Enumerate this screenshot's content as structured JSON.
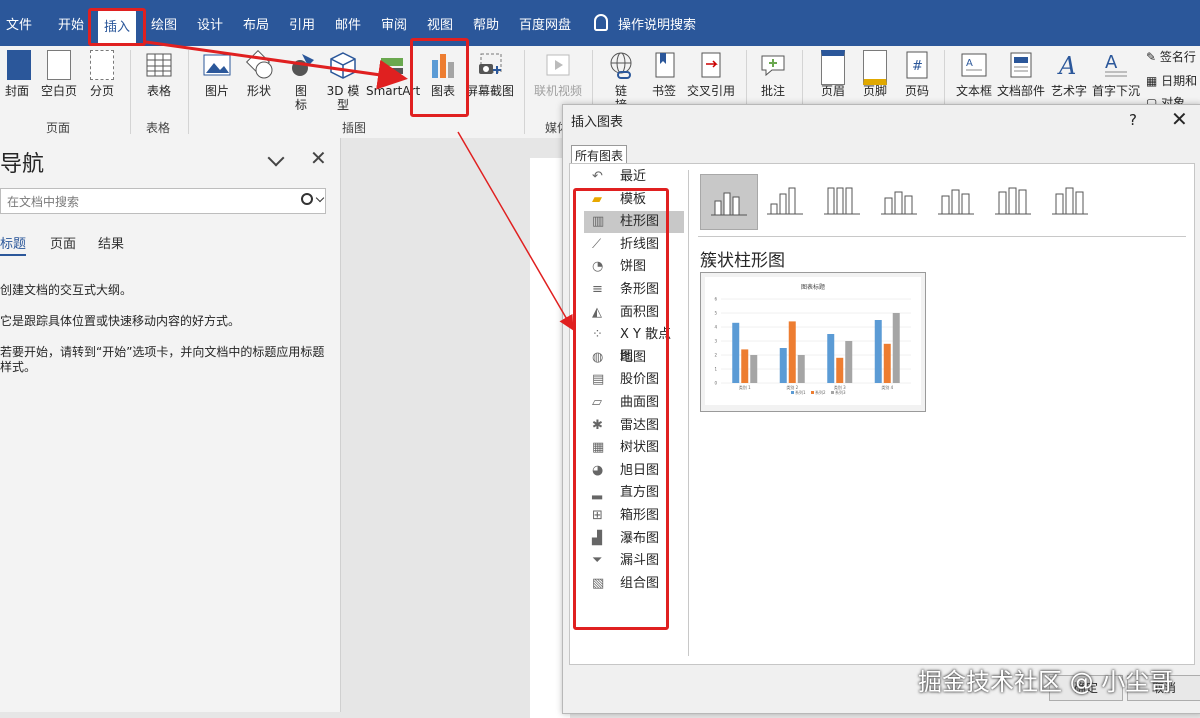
{
  "tabs": [
    "文件",
    "开始",
    "插入",
    "绘图",
    "设计",
    "布局",
    "引用",
    "邮件",
    "审阅",
    "视图",
    "帮助",
    "百度网盘"
  ],
  "active_tab": "插入",
  "search_hint": "操作说明搜索",
  "ribbon": {
    "items": {
      "cover": "封面",
      "blank_page": "空白页",
      "page_break": "分页",
      "table": "表格",
      "picture": "图片",
      "shapes": "形状",
      "icons_top": "图",
      "icons_bottom": "标",
      "model3d_top": "3D 模",
      "model3d_bottom": "型",
      "smartart": "SmartArt",
      "chart": "图表",
      "screenshot": "屏幕截图",
      "online_video": "联机视频",
      "link": "链",
      "link_cut": "接",
      "bookmark": "书签",
      "cross_ref": "交叉引用",
      "comment": "批注",
      "header": "页眉",
      "footer": "页脚",
      "page_number": "页码",
      "textbox": "文本框",
      "quick_parts": "文档部件",
      "wordart": "艺术字",
      "dropcap": "首字下沉",
      "signature": "签名行",
      "datetime": "日期和",
      "object": "对象"
    },
    "groups": {
      "pages": "页面",
      "tables": "表格",
      "illustrations": "插图",
      "media": "媒体"
    }
  },
  "nav": {
    "title": "导航",
    "search_placeholder": "在文档中搜索",
    "tabs": [
      "标题",
      "页面",
      "结果"
    ],
    "text1": "创建文档的交互式大纲。",
    "text2": "它是跟踪具体位置或快速移动内容的好方式。",
    "text3a": "若要开始，请转到“开始”选项卡，并向文档中的标题应用标题",
    "text3b": "样式。"
  },
  "dialog": {
    "title": "插入图表",
    "help": "?",
    "tab": "所有图表",
    "chart_types": [
      "最近",
      "模板",
      "柱形图",
      "折线图",
      "饼图",
      "条形图",
      "面积图",
      "X Y 散点图",
      "地图",
      "股价图",
      "曲面图",
      "雷达图",
      "树状图",
      "旭日图",
      "直方图",
      "箱形图",
      "瀑布图",
      "漏斗图",
      "组合图"
    ],
    "selected_type": "柱形图",
    "subtype_title": "簇状柱形图",
    "ok_label": "确定",
    "cancel_label": "取消"
  },
  "preview_chart": {
    "title": "图表标题",
    "categories": [
      "类别 1",
      "类别 2",
      "类别 3",
      "类别 4"
    ],
    "series": [
      {
        "name": "系列1",
        "values": [
          4.3,
          2.5,
          3.5,
          4.5
        ],
        "color": "#5b9bd5"
      },
      {
        "name": "系列2",
        "values": [
          2.4,
          4.4,
          1.8,
          2.8
        ],
        "color": "#ed7d31"
      },
      {
        "name": "系列3",
        "values": [
          2.0,
          2.0,
          3.0,
          5.0
        ],
        "color": "#a5a5a5"
      }
    ],
    "ylim": [
      0,
      6
    ],
    "yticks": [
      "0",
      "1",
      "2",
      "3",
      "4",
      "5",
      "6"
    ]
  },
  "watermark": "掘金技术社区 @ 小尘哥",
  "colors": {
    "titlebar": "#2b579a",
    "highlight": "#e02020"
  }
}
